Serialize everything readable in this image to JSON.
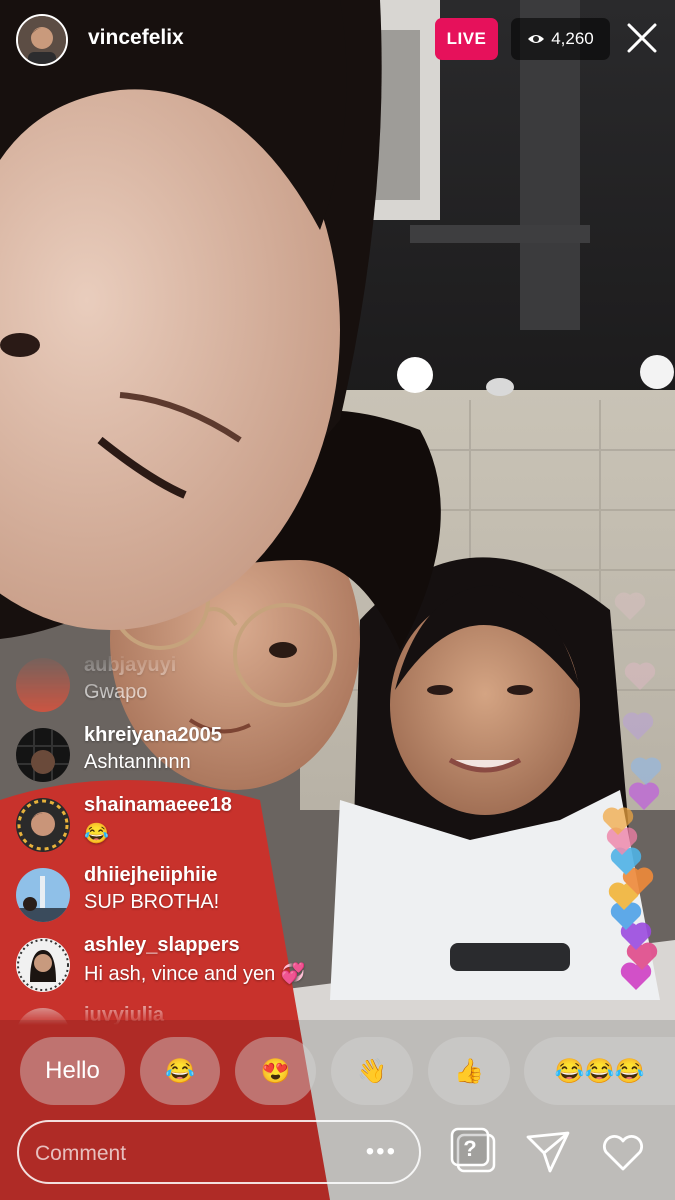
{
  "host": {
    "username": "vincefelix",
    "avatar_icon": "profile-photo"
  },
  "status": {
    "live_label": "LIVE",
    "viewer_count": "4,260",
    "live_color": "#e6115b"
  },
  "comments": [
    {
      "username": "aubjayuyi",
      "text": "Gwapo"
    },
    {
      "username": "khreiyana2005",
      "text": "Ashtannnnn"
    },
    {
      "username": "shainamaeee18",
      "text": "😂"
    },
    {
      "username": "dhiiejheiiphiie",
      "text": "SUP BROTHA!"
    },
    {
      "username": "ashley_slappers",
      "text": "Hi ash, vince and yen 💞"
    },
    {
      "username": "iuvyiulia",
      "text": ""
    }
  ],
  "quick_replies": [
    "Hello",
    "😂",
    "😍",
    "👋",
    "👍",
    "😂😂😂"
  ],
  "composer": {
    "placeholder": "Comment",
    "more_label": "•••"
  },
  "icons": {
    "close": "close-icon",
    "eye": "eye-icon",
    "question": "question-sticker-icon",
    "share": "send-icon",
    "like": "heart-icon"
  }
}
